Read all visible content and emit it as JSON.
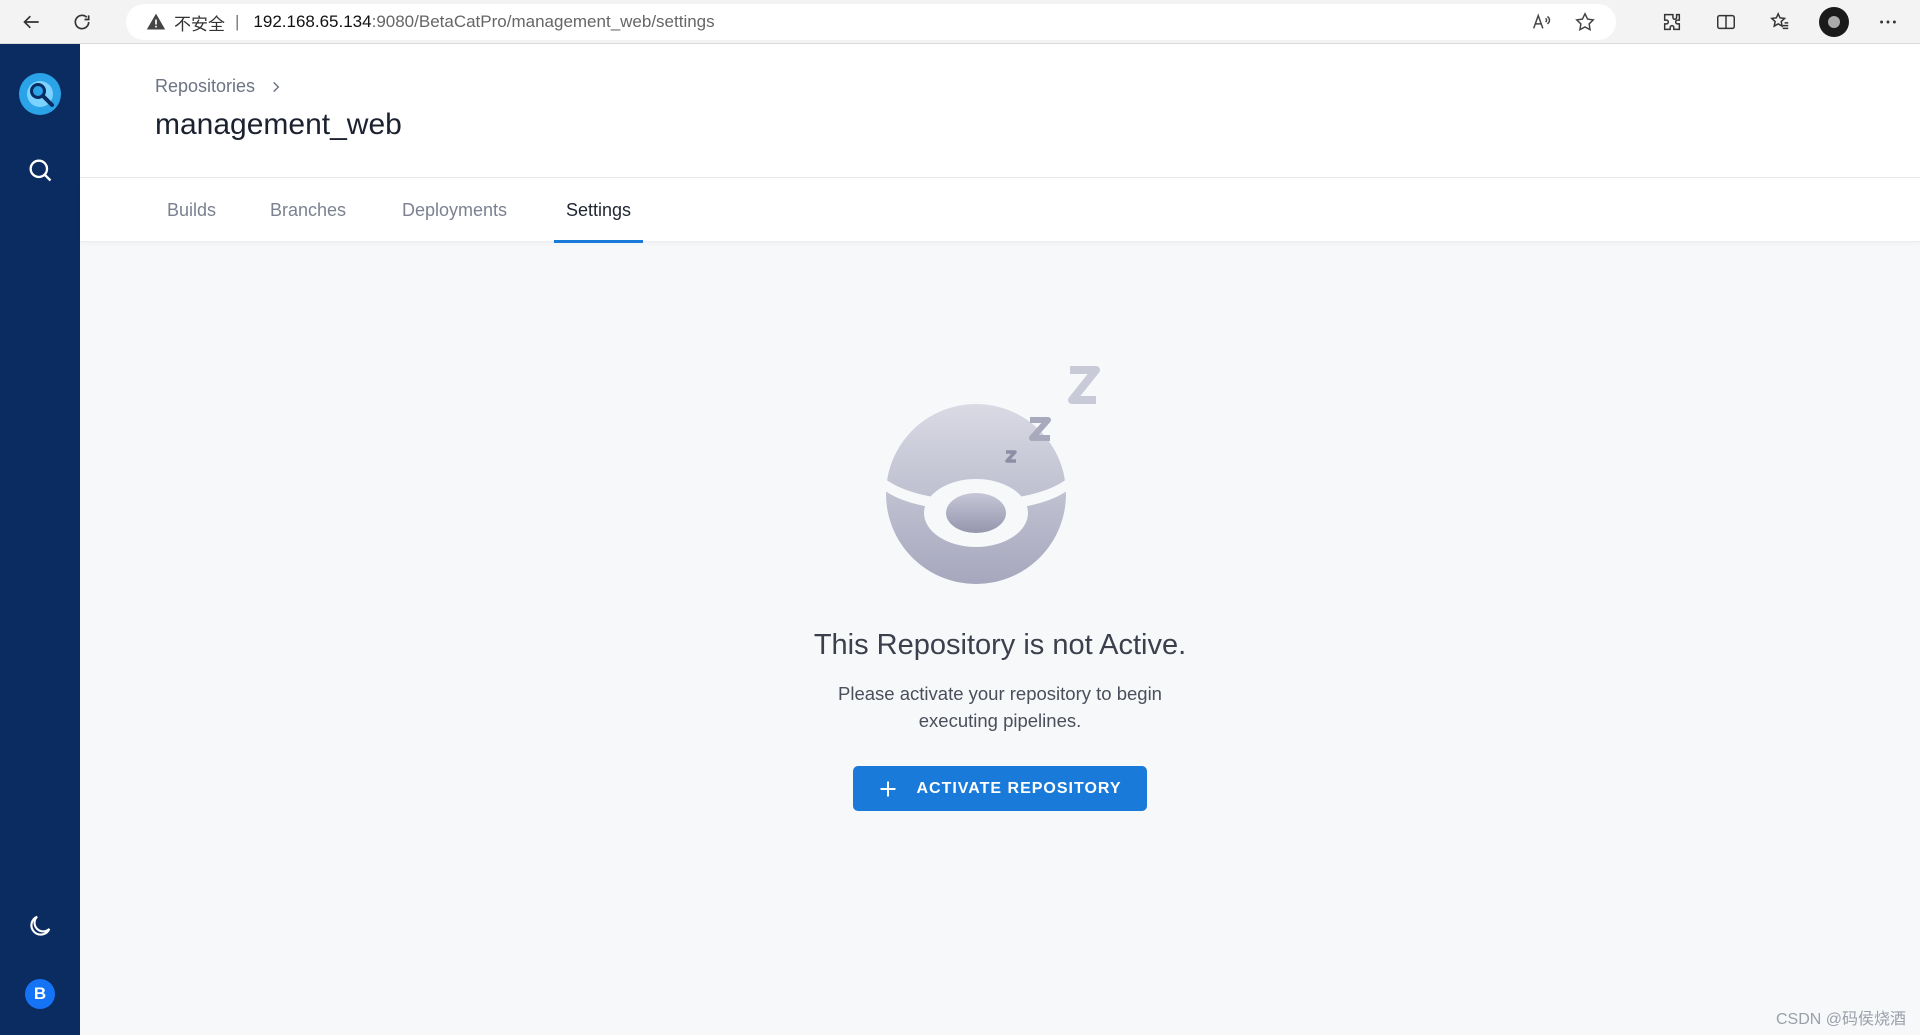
{
  "browser": {
    "insecure_label": "不安全",
    "separator": "|",
    "url_host": "192.168.65.134",
    "url_path": ":9080/BetaCatPro/management_web/settings"
  },
  "header": {
    "breadcrumb_label": "Repositories",
    "title": "management_web"
  },
  "tabs": [
    {
      "label": "Builds"
    },
    {
      "label": "Branches"
    },
    {
      "label": "Deployments"
    },
    {
      "label": "Settings"
    }
  ],
  "empty_state": {
    "title": "This Repository is not Active.",
    "description": "Please activate your repository to begin executing pipelines.",
    "button_label": "ACTIVATE REPOSITORY"
  },
  "sidebar": {
    "user_initial": "B"
  },
  "watermark": "CSDN @码侯烧酒",
  "colors": {
    "sidebar": "#0b2c61",
    "accent": "#1a7ad9",
    "user_badge": "#1574f6"
  }
}
